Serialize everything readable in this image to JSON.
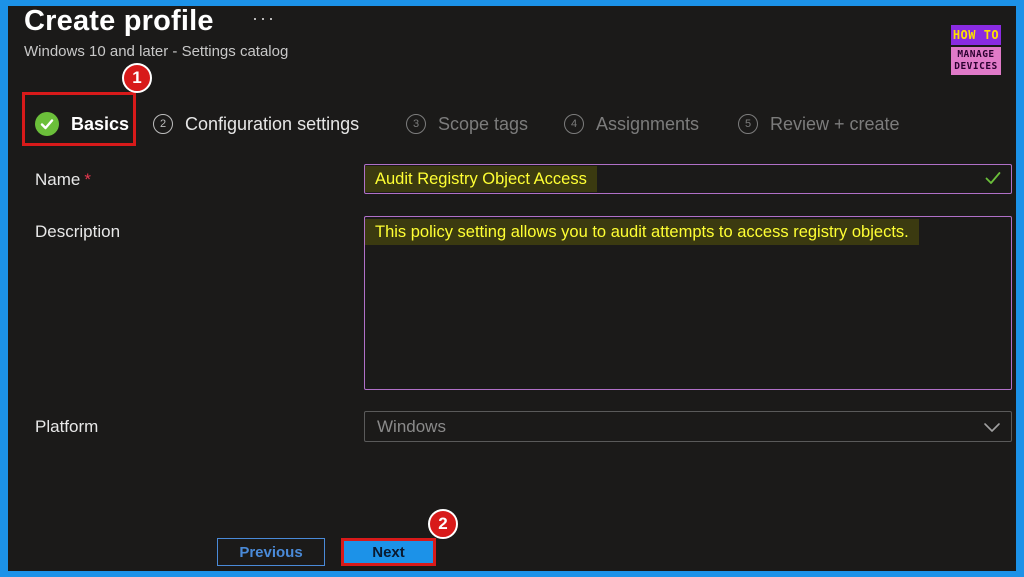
{
  "header": {
    "title": "Create profile",
    "more_label": "···",
    "subtitle": "Windows 10 and later - Settings catalog"
  },
  "logo": {
    "line1": "HOW TO",
    "line2": "MANAGE",
    "line3": "DEVICES"
  },
  "steps": [
    {
      "num": "",
      "label": "Basics",
      "state": "completed"
    },
    {
      "num": "2",
      "label": "Configuration settings",
      "state": "normal"
    },
    {
      "num": "3",
      "label": "Scope tags",
      "state": "disabled"
    },
    {
      "num": "4",
      "label": "Assignments",
      "state": "disabled"
    },
    {
      "num": "5",
      "label": "Review + create",
      "state": "disabled"
    }
  ],
  "annotations": {
    "badge1": "1",
    "badge2": "2"
  },
  "form": {
    "name_label": "Name",
    "required_marker": "*",
    "name_value": "Audit Registry Object Access",
    "description_label": "Description",
    "description_value": "This policy setting allows you to audit attempts to access registry objects.",
    "platform_label": "Platform",
    "platform_value": "Windows"
  },
  "footer": {
    "previous_label": "Previous",
    "next_label": "Next"
  },
  "colors": {
    "background": "#1b1a19",
    "frame": "#1c92e8",
    "highlight_red": "#d81a1a",
    "field_border": "#b070c8",
    "text_highlight": "#ffff33",
    "success_green": "#6bbf3a"
  }
}
